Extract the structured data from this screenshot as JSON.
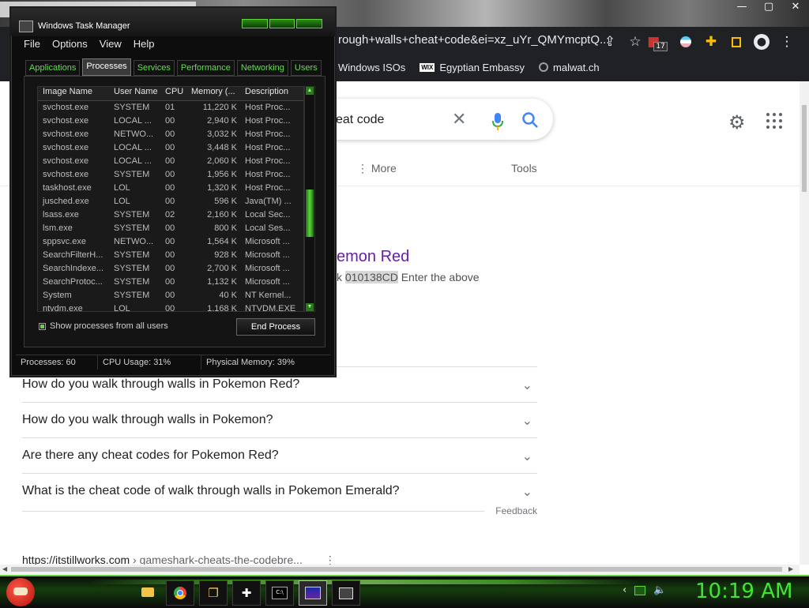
{
  "browser": {
    "window_controls": [
      "❐",
      "—",
      "▢",
      "✕"
    ],
    "url_visible": "rough+walls+cheat+code&ei=xz_uYr_QMYmcptQ...",
    "bookmarks": [
      {
        "label": "Windows ISOs"
      },
      {
        "label": "Egyptian Embassy",
        "icon_text": "WIX"
      },
      {
        "label": "malwat.ch"
      }
    ],
    "extension_badge": "17"
  },
  "google": {
    "search_text": "eat code",
    "tabs": {
      "more": "More",
      "tools": "Tools"
    },
    "result": {
      "title": "emon Red",
      "snippet_pre": "k ",
      "snippet_highlight": "010138CD",
      "snippet_post": " Enter the above"
    },
    "people_also_ask": [
      "How do you walk through walls in Pokemon Red?",
      "How do you walk through walls in Pokemon?",
      "Are there any cheat codes for Pokemon Red?",
      "What is the cheat code of walk through walls in Pokemon Emerald?"
    ],
    "feedback": "Feedback",
    "next_result_url": "https://itstillworks.com",
    "next_result_path": " › gameshark-cheats-the-codebre..."
  },
  "task_manager": {
    "title": "Windows Task Manager",
    "menu": [
      "File",
      "Options",
      "View",
      "Help"
    ],
    "tabs": [
      {
        "label": "Applications",
        "active": false
      },
      {
        "label": "Processes",
        "active": true
      },
      {
        "label": "Services",
        "active": false
      },
      {
        "label": "Performance",
        "active": false
      },
      {
        "label": "Networking",
        "active": false
      },
      {
        "label": "Users",
        "active": false
      }
    ],
    "columns": [
      "Image Name",
      "User Name",
      "CPU",
      "Memory (...",
      "Description"
    ],
    "rows": [
      [
        "svchost.exe",
        "SYSTEM",
        "01",
        "11,220 K",
        "Host Proc..."
      ],
      [
        "svchost.exe",
        "LOCAL ...",
        "00",
        "2,940 K",
        "Host Proc..."
      ],
      [
        "svchost.exe",
        "NETWO...",
        "00",
        "3,032 K",
        "Host Proc..."
      ],
      [
        "svchost.exe",
        "LOCAL ...",
        "00",
        "3,448 K",
        "Host Proc..."
      ],
      [
        "svchost.exe",
        "LOCAL ...",
        "00",
        "2,060 K",
        "Host Proc..."
      ],
      [
        "svchost.exe",
        "SYSTEM",
        "00",
        "1,956 K",
        "Host Proc..."
      ],
      [
        "taskhost.exe",
        "LOL",
        "00",
        "1,320 K",
        "Host Proc..."
      ],
      [
        "jusched.exe",
        "LOL",
        "00",
        "596 K",
        "Java(TM) ..."
      ],
      [
        "lsass.exe",
        "SYSTEM",
        "02",
        "2,160 K",
        "Local Sec..."
      ],
      [
        "lsm.exe",
        "SYSTEM",
        "00",
        "800 K",
        "Local Ses..."
      ],
      [
        "sppsvc.exe",
        "NETWO...",
        "00",
        "1,564 K",
        "Microsoft ..."
      ],
      [
        "SearchFilterH...",
        "SYSTEM",
        "00",
        "928 K",
        "Microsoft ..."
      ],
      [
        "SearchIndexe...",
        "SYSTEM",
        "00",
        "2,700 K",
        "Microsoft ..."
      ],
      [
        "SearchProtoc...",
        "SYSTEM",
        "00",
        "1,132 K",
        "Microsoft ..."
      ],
      [
        "System",
        "SYSTEM",
        "00",
        "40 K",
        "NT Kernel..."
      ],
      [
        "ntvdm.exe",
        "LOL",
        "00",
        "1,168 K",
        "NTVDM.EXE"
      ]
    ],
    "show_all_label": "Show processes from all users",
    "end_process_label": "End Process",
    "status": {
      "processes": "Processes: 60",
      "cpu": "CPU Usage: 31%",
      "memory": "Physical Memory: 39%"
    }
  },
  "taskbar": {
    "apps": [
      "folder-icon",
      "chrome-icon",
      "chat-icon",
      "plus-icon",
      "cmd-icon",
      "paint-icon",
      "task-manager-icon"
    ],
    "clock": "10:19 AM"
  }
}
